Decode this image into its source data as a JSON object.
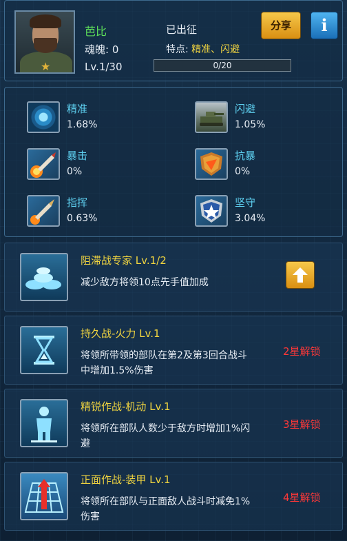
{
  "header": {
    "name": "芭比",
    "soul": "魂魄: 0",
    "level": "Lv.1/30",
    "status": "已出征",
    "trait_label": "特点: ",
    "trait_value": "精准、闪避",
    "progress": {
      "text": "0/20",
      "value": 0,
      "max": 20
    },
    "share_label": "分享",
    "info_label": "i"
  },
  "stats": [
    {
      "name": "精准",
      "value": "1.68%",
      "icon": "accuracy-radar-icon"
    },
    {
      "name": "闪避",
      "value": "1.05%",
      "icon": "tank-dodge-icon"
    },
    {
      "name": "暴击",
      "value": "0%",
      "icon": "crit-missile-icon"
    },
    {
      "name": "抗暴",
      "value": "0%",
      "icon": "crit-resist-shield-icon"
    },
    {
      "name": "指挥",
      "value": "0.63%",
      "icon": "command-shell-icon"
    },
    {
      "name": "坚守",
      "value": "3.04%",
      "icon": "defense-star-shield-icon"
    }
  ],
  "skills": [
    {
      "title": "阻滞战专家 Lv.1/2",
      "desc": "减少敌方将领10点先手值加成",
      "lock": "",
      "icon": "sandbag-barrier-icon"
    },
    {
      "title": "持久战-火力 Lv.1",
      "desc": "将领所带领的部队在第2及第3回合战斗中增加1.5%伤害",
      "lock": "2星解锁",
      "icon": "hourglass-icon"
    },
    {
      "title": "精锐作战-机动 Lv.1",
      "desc": "将领所在部队人数少于敌方时增加1%闪避",
      "lock": "3星解锁",
      "icon": "soldier-icon"
    },
    {
      "title": "正面作战-装甲 Lv.1",
      "desc": "将领所在部队与正面敌人战斗时减免1%伤害",
      "lock": "4星解锁",
      "icon": "grid-arrow-icon"
    }
  ]
}
